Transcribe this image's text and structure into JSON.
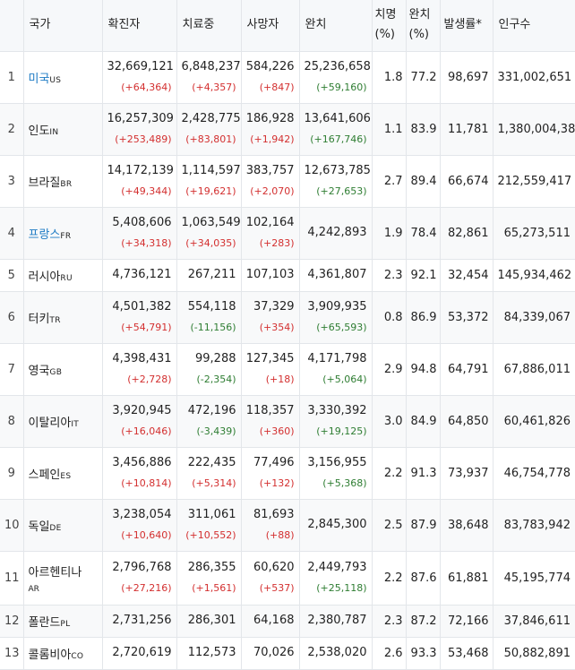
{
  "headers": {
    "country": "국가",
    "confirmed": "확진자",
    "active": "치료중",
    "deaths": "사망자",
    "recovered": "완치",
    "fatality": "치명\n(%)",
    "recovery_rate": "완치\n(%)",
    "incidence": "발생률*",
    "population": "인구수"
  },
  "rows": [
    {
      "idx": "1",
      "name": "미국",
      "code": "US",
      "link": true,
      "confirmed": "32,669,121",
      "confirmed_delta": "(+64,364)",
      "active": "6,848,237",
      "active_delta": "(+4,357)",
      "active_sign": "pos",
      "deaths": "584,226",
      "deaths_delta": "(+847)",
      "recovered": "25,236,658",
      "recovered_delta": "(+59,160)",
      "fatality": "1.8",
      "recovery_rate": "77.2",
      "incidence": "98,697",
      "population": "331,002,651"
    },
    {
      "idx": "2",
      "name": "인도",
      "code": "IN",
      "link": false,
      "confirmed": "16,257,309",
      "confirmed_delta": "(+253,489)",
      "active": "2,428,775",
      "active_delta": "(+83,801)",
      "active_sign": "pos",
      "deaths": "186,928",
      "deaths_delta": "(+1,942)",
      "recovered": "13,641,606",
      "recovered_delta": "(+167,746)",
      "fatality": "1.1",
      "recovery_rate": "83.9",
      "incidence": "11,781",
      "population": "1,380,004,385"
    },
    {
      "idx": "3",
      "name": "브라질",
      "code": "BR",
      "link": false,
      "confirmed": "14,172,139",
      "confirmed_delta": "(+49,344)",
      "active": "1,114,597",
      "active_delta": "(+19,621)",
      "active_sign": "pos",
      "deaths": "383,757",
      "deaths_delta": "(+2,070)",
      "recovered": "12,673,785",
      "recovered_delta": "(+27,653)",
      "fatality": "2.7",
      "recovery_rate": "89.4",
      "incidence": "66,674",
      "population": "212,559,417"
    },
    {
      "idx": "4",
      "name": "프랑스",
      "code": "FR",
      "link": true,
      "confirmed": "5,408,606",
      "confirmed_delta": "(+34,318)",
      "active": "1,063,549",
      "active_delta": "(+34,035)",
      "active_sign": "pos",
      "deaths": "102,164",
      "deaths_delta": "(+283)",
      "recovered": "4,242,893",
      "recovered_delta": "",
      "fatality": "1.9",
      "recovery_rate": "78.4",
      "incidence": "82,861",
      "population": "65,273,511"
    },
    {
      "idx": "5",
      "name": "러시아",
      "code": "RU",
      "link": false,
      "confirmed": "4,736,121",
      "confirmed_delta": "",
      "active": "267,211",
      "active_delta": "",
      "active_sign": "pos",
      "deaths": "107,103",
      "deaths_delta": "",
      "recovered": "4,361,807",
      "recovered_delta": "",
      "fatality": "2.3",
      "recovery_rate": "92.1",
      "incidence": "32,454",
      "population": "145,934,462"
    },
    {
      "idx": "6",
      "name": "터키",
      "code": "TR",
      "link": false,
      "confirmed": "4,501,382",
      "confirmed_delta": "(+54,791)",
      "active": "554,118",
      "active_delta": "(-11,156)",
      "active_sign": "neg",
      "deaths": "37,329",
      "deaths_delta": "(+354)",
      "recovered": "3,909,935",
      "recovered_delta": "(+65,593)",
      "fatality": "0.8",
      "recovery_rate": "86.9",
      "incidence": "53,372",
      "population": "84,339,067"
    },
    {
      "idx": "7",
      "name": "영국",
      "code": "GB",
      "link": false,
      "confirmed": "4,398,431",
      "confirmed_delta": "(+2,728)",
      "active": "99,288",
      "active_delta": "(-2,354)",
      "active_sign": "neg",
      "deaths": "127,345",
      "deaths_delta": "(+18)",
      "recovered": "4,171,798",
      "recovered_delta": "(+5,064)",
      "fatality": "2.9",
      "recovery_rate": "94.8",
      "incidence": "64,791",
      "population": "67,886,011"
    },
    {
      "idx": "8",
      "name": "이탈리아",
      "code": "IT",
      "link": false,
      "confirmed": "3,920,945",
      "confirmed_delta": "(+16,046)",
      "active": "472,196",
      "active_delta": "(-3,439)",
      "active_sign": "neg",
      "deaths": "118,357",
      "deaths_delta": "(+360)",
      "recovered": "3,330,392",
      "recovered_delta": "(+19,125)",
      "fatality": "3.0",
      "recovery_rate": "84.9",
      "incidence": "64,850",
      "population": "60,461,826"
    },
    {
      "idx": "9",
      "name": "스페인",
      "code": "ES",
      "link": false,
      "confirmed": "3,456,886",
      "confirmed_delta": "(+10,814)",
      "active": "222,435",
      "active_delta": "(+5,314)",
      "active_sign": "pos",
      "deaths": "77,496",
      "deaths_delta": "(+132)",
      "recovered": "3,156,955",
      "recovered_delta": "(+5,368)",
      "fatality": "2.2",
      "recovery_rate": "91.3",
      "incidence": "73,937",
      "population": "46,754,778"
    },
    {
      "idx": "10",
      "name": "독일",
      "code": "DE",
      "link": false,
      "confirmed": "3,238,054",
      "confirmed_delta": "(+10,640)",
      "active": "311,061",
      "active_delta": "(+10,552)",
      "active_sign": "pos",
      "deaths": "81,693",
      "deaths_delta": "(+88)",
      "recovered": "2,845,300",
      "recovered_delta": "",
      "fatality": "2.5",
      "recovery_rate": "87.9",
      "incidence": "38,648",
      "population": "83,783,942"
    },
    {
      "idx": "11",
      "name": "아르헨티나",
      "code": "AR",
      "link": false,
      "confirmed": "2,796,768",
      "confirmed_delta": "(+27,216)",
      "active": "286,355",
      "active_delta": "(+1,561)",
      "active_sign": "pos",
      "deaths": "60,620",
      "deaths_delta": "(+537)",
      "recovered": "2,449,793",
      "recovered_delta": "(+25,118)",
      "fatality": "2.2",
      "recovery_rate": "87.6",
      "incidence": "61,881",
      "population": "45,195,774"
    },
    {
      "idx": "12",
      "name": "폴란드",
      "code": "PL",
      "link": false,
      "confirmed": "2,731,256",
      "confirmed_delta": "",
      "active": "286,301",
      "active_delta": "",
      "active_sign": "pos",
      "deaths": "64,168",
      "deaths_delta": "",
      "recovered": "2,380,787",
      "recovered_delta": "",
      "fatality": "2.3",
      "recovery_rate": "87.2",
      "incidence": "72,166",
      "population": "37,846,611"
    },
    {
      "idx": "13",
      "name": "콜롬비아",
      "code": "CO",
      "link": false,
      "confirmed": "2,720,619",
      "confirmed_delta": "",
      "active": "112,573",
      "active_delta": "",
      "active_sign": "pos",
      "deaths": "70,026",
      "deaths_delta": "",
      "recovered": "2,538,020",
      "recovered_delta": "",
      "fatality": "2.6",
      "recovery_rate": "93.3",
      "incidence": "53,468",
      "population": "50,882,891"
    }
  ],
  "colors": {
    "link": "#1e7bc4",
    "increase": "#d32f2f",
    "decrease": "#2e7d32",
    "header_bg": "#f6f8fa",
    "border": "#e3e6ea"
  }
}
